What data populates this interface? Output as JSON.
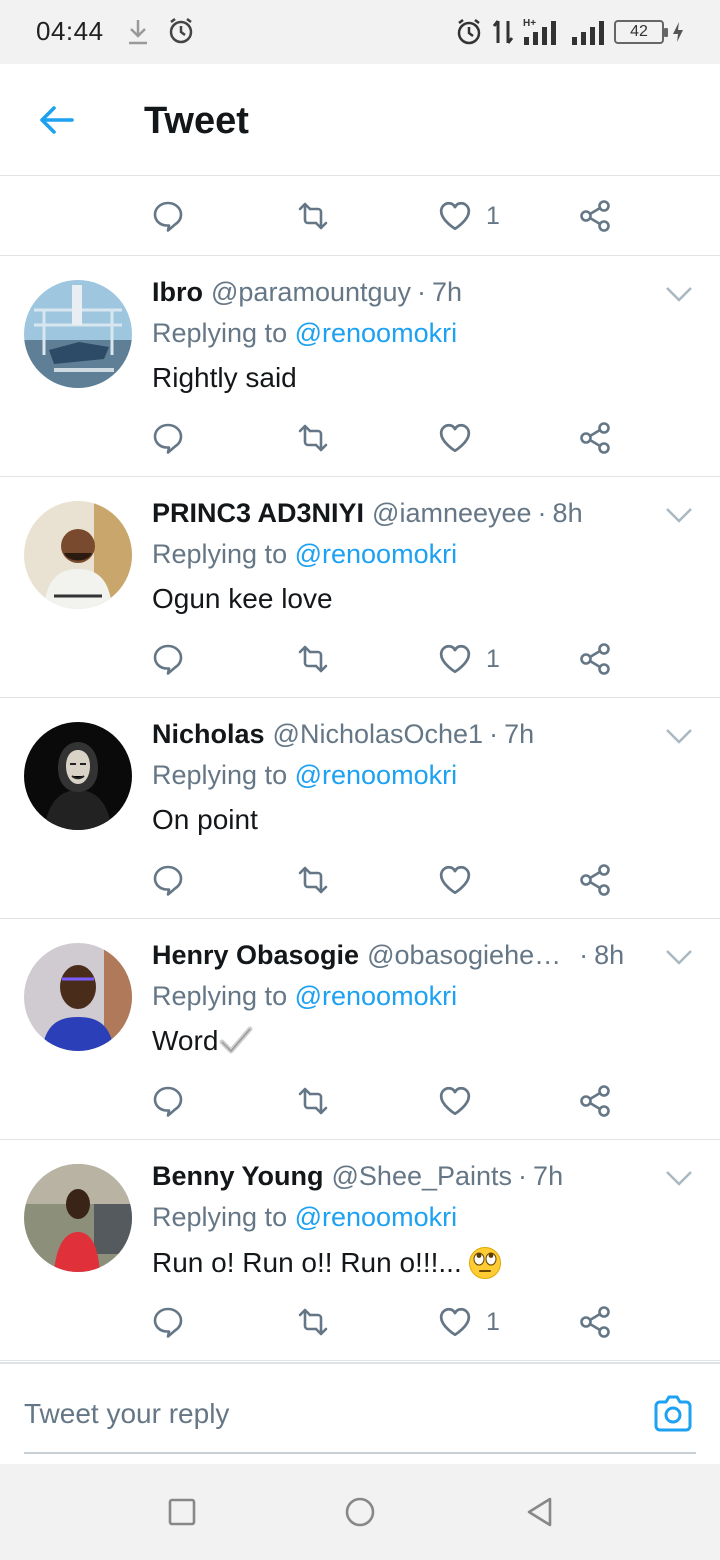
{
  "status_bar": {
    "time": "04:44",
    "battery": "42",
    "icons": [
      "download-icon",
      "alarm-icon",
      "data-arrows-icon",
      "signal-icon",
      "battery-icon",
      "charging-icon"
    ]
  },
  "header": {
    "title": "Tweet",
    "back_icon": "arrow-left-icon"
  },
  "colors": {
    "accent": "#1da1f2",
    "secondary_text": "#657786",
    "primary_text": "#14171a",
    "divider": "#dfe3e6"
  },
  "top_actions": {
    "like_count": "1"
  },
  "tweets": [
    {
      "name": "Ibro",
      "handle": "@paramountguy",
      "time": "7h",
      "replying_label": "Replying to",
      "replying_to": "@renoomokri",
      "text": "Rightly said",
      "like_count": ""
    },
    {
      "name": "PRINC3 AD3NIYI",
      "handle": "@iamneeyee",
      "time": "8h",
      "replying_label": "Replying to",
      "replying_to": "@renoomokri",
      "text": "Ogun kee love",
      "like_count": "1"
    },
    {
      "name": "Nicholas",
      "handle": "@NicholasOche1",
      "time": "7h",
      "replying_label": "Replying to",
      "replying_to": "@renoomokri",
      "text": "On point",
      "like_count": ""
    },
    {
      "name": "Henry Obasogie",
      "handle": "@obasogiehe…",
      "time": "8h",
      "replying_label": "Replying to",
      "replying_to": "@renoomokri",
      "text": "Word",
      "emoji": "✔️",
      "like_count": ""
    },
    {
      "name": "Benny Young",
      "handle": "@Shee_Paints",
      "time": "7h",
      "replying_label": "Replying to",
      "replying_to": "@renoomokri",
      "text": "Run o! Run o!! Run o!!!...",
      "emoji": "🙄",
      "like_count": "1"
    }
  ],
  "reply_bar": {
    "placeholder": "Tweet your reply",
    "camera_icon": "camera-icon"
  },
  "nav_bar": {
    "buttons": [
      "recents-square-icon",
      "home-circle-icon",
      "back-triangle-icon"
    ]
  }
}
